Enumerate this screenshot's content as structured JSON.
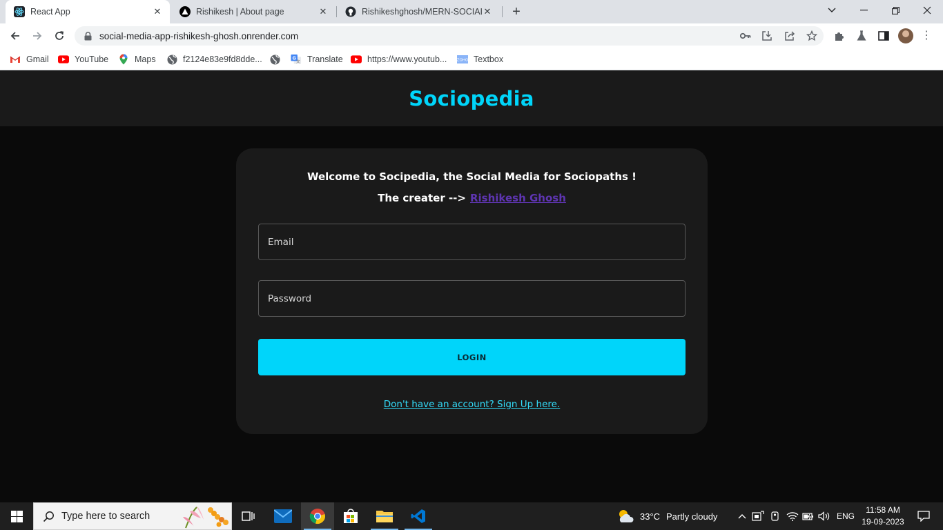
{
  "browser": {
    "tabs": [
      {
        "title": "React App",
        "active": true,
        "icon": "react-icon"
      },
      {
        "title": "Rishikesh | About page",
        "active": false,
        "icon": "triangle-icon"
      },
      {
        "title": "Rishikeshghosh/MERN-SOCIAL-",
        "active": false,
        "icon": "github-icon"
      }
    ],
    "url": "social-media-app-rishikesh-ghosh.onrender.com",
    "bookmarks": [
      {
        "label": "Gmail",
        "icon": "gmail-icon"
      },
      {
        "label": "YouTube",
        "icon": "youtube-icon"
      },
      {
        "label": "Maps",
        "icon": "maps-icon"
      },
      {
        "label": "f2124e83e9fd8dde...",
        "icon": "globe-icon"
      },
      {
        "label": "",
        "icon": "globe-icon"
      },
      {
        "label": "Translate",
        "icon": "translate-icon"
      },
      {
        "label": "https://www.youtub...",
        "icon": "youtube-icon"
      },
      {
        "label": "Textbox",
        "icon": "zoho-icon"
      }
    ]
  },
  "app": {
    "brand": "Sociopedia",
    "welcome": "Welcome to Socipedia, the Social Media for Sociopaths !",
    "creator_prefix": "The creater  -->",
    "creator_link": "Rishikesh Ghosh",
    "email_placeholder": "Email",
    "password_placeholder": "Password",
    "login_label": "LOGIN",
    "signup_link": "Don't have an account? Sign Up here.",
    "colors": {
      "accent": "#00d5fa",
      "header_bg": "#1a1a1a",
      "page_bg": "#0a0a0a",
      "card_bg": "#1a1a1a",
      "creator_link": "#5e35b1"
    }
  },
  "taskbar": {
    "search_placeholder": "Type here to search",
    "weather_temp": "33°C",
    "weather_desc": "Partly cloudy",
    "lang": "ENG",
    "time": "11:58 AM",
    "date": "19-09-2023"
  }
}
